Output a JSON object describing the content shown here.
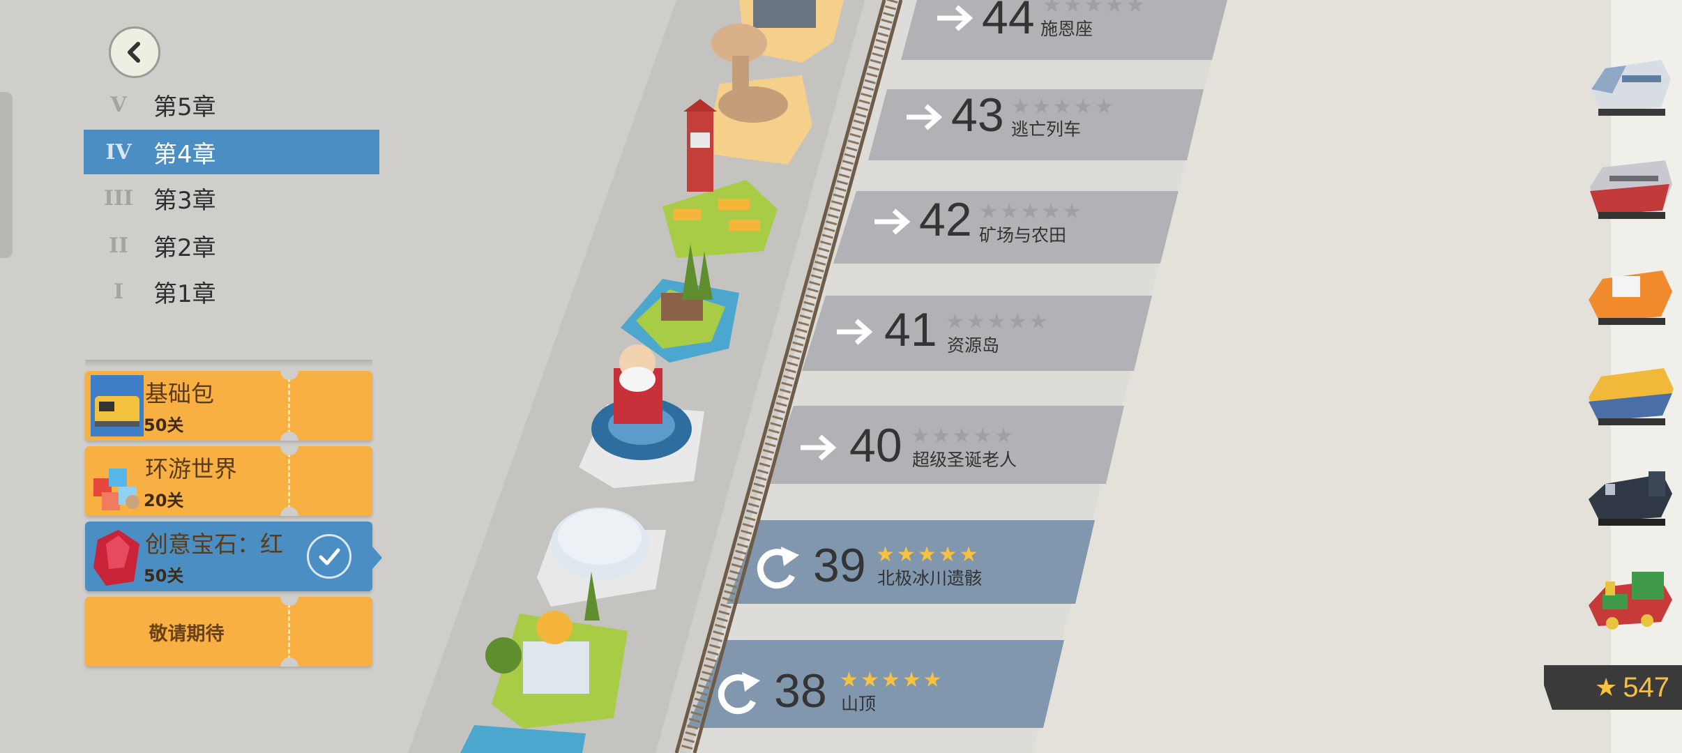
{
  "chapters": [
    {
      "num": "V",
      "label": "第5章"
    },
    {
      "num": "IV",
      "label": "第4章"
    },
    {
      "num": "III",
      "label": "第3章"
    },
    {
      "num": "II",
      "label": "第2章"
    },
    {
      "num": "I",
      "label": "第1章"
    }
  ],
  "active_chapter": "第4章",
  "packs": [
    {
      "name": "基础包",
      "count": "50关"
    },
    {
      "name": "环游世界",
      "count": "20关"
    },
    {
      "name": "创意宝石：红",
      "count": "50关"
    },
    {
      "name": "敬请期待"
    }
  ],
  "levels": [
    {
      "number": "44",
      "name": "施恩座",
      "stars": 0,
      "status": "locked"
    },
    {
      "number": "43",
      "name": "逃亡列车",
      "stars": 0,
      "status": "locked"
    },
    {
      "number": "42",
      "name": "矿场与农田",
      "stars": 0,
      "status": "locked"
    },
    {
      "number": "41",
      "name": "资源岛",
      "stars": 0,
      "status": "locked"
    },
    {
      "number": "40",
      "name": "超级圣诞老人",
      "stars": 0,
      "status": "locked"
    },
    {
      "number": "39",
      "name": "北极冰川遗骸",
      "stars": 5,
      "status": "completed"
    },
    {
      "number": "38",
      "name": "山顶",
      "stars": 5,
      "status": "completed"
    }
  ],
  "star_glyph": "★★★★★",
  "total_stars": "547",
  "colors": {
    "background": "#cfceca",
    "road": "#dddcd9",
    "locked_band": "#b1b2b6",
    "completed_band": "#8197ae",
    "selected_blue": "#4a8ec4",
    "pack_orange": "#f8b043",
    "star_gold": "#f6c240"
  },
  "trains": [
    "silver-bullet-train-icon",
    "red-electric-train-icon",
    "orange-diesel-train-icon",
    "yellow-diesel-train-icon",
    "steam-locomotive-icon",
    "green-red-toy-train-icon"
  ]
}
